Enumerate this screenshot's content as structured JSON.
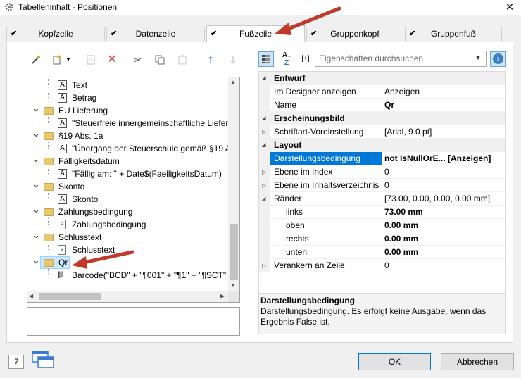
{
  "window": {
    "title": "Tabelleninhalt - Positionen",
    "close_glyph": "✕"
  },
  "tabs": [
    {
      "label": "Kopfzeile",
      "checked": true
    },
    {
      "label": "Datenzeile",
      "checked": true
    },
    {
      "label": "Fußzeile",
      "checked": true,
      "active": true
    },
    {
      "label": "Gruppenkopf",
      "checked": true
    },
    {
      "label": "Gruppenfuß",
      "checked": true
    }
  ],
  "toolbar_icons": [
    "wand-icon",
    "new-object-icon",
    "dropdown-icon",
    "properties-icon",
    "delete-icon",
    "cut-icon",
    "copy-icon",
    "paste-icon",
    "move-up-icon",
    "move-down-icon"
  ],
  "tree": [
    {
      "kind": "text",
      "label": "Text"
    },
    {
      "kind": "text",
      "label": "Betrag"
    },
    {
      "kind": "folder",
      "label": "EU Lieferung"
    },
    {
      "kind": "text",
      "label": "\"Steuerfreie innergemeinschaftliche Liefer"
    },
    {
      "kind": "folder",
      "label": "§19 Abs. 1a"
    },
    {
      "kind": "text",
      "label": "\"Übergang der Steuerschuld gemäß §19 Ab"
    },
    {
      "kind": "folder",
      "label": "Fälligkeitsdatum"
    },
    {
      "kind": "text",
      "label": "\"Fällig am: \" + Date$(FaelligkeitsDatum)"
    },
    {
      "kind": "folder",
      "label": "Skonto"
    },
    {
      "kind": "text",
      "label": "Skonto"
    },
    {
      "kind": "folder",
      "label": "Zahlungsbedingung"
    },
    {
      "kind": "para",
      "label": "Zahlungsbedingung"
    },
    {
      "kind": "folder",
      "label": "Schlusstext"
    },
    {
      "kind": "para",
      "label": "Schlusstext"
    },
    {
      "kind": "folder",
      "label": "Qr"
    },
    {
      "kind": "barcode",
      "label": "Barcode(\"BCD\" + \"¶001\" + \"¶1\" + \"¶SCT\" + "
    }
  ],
  "search": {
    "placeholder": "Eigenschaften durchsuchen"
  },
  "properties": [
    {
      "type": "cat",
      "name": "Entwurf"
    },
    {
      "type": "prop",
      "name": "Im Designer anzeigen",
      "value": "Anzeigen"
    },
    {
      "type": "prop",
      "name": "Name",
      "value": "Qr",
      "bold": true
    },
    {
      "type": "cat",
      "name": "Erscheinungsbild"
    },
    {
      "type": "prop",
      "name": "Schriftart-Voreinstellung",
      "value": "[Arial, 9.0 pt]",
      "toggle": true
    },
    {
      "type": "cat",
      "name": "Layout"
    },
    {
      "type": "prop",
      "name": "Darstellungsbedingung",
      "value": "not IsNullOrE... [Anzeigen]",
      "bold": true,
      "selected": true
    },
    {
      "type": "prop",
      "name": "Ebene im Index",
      "value": "0",
      "toggle": true
    },
    {
      "type": "prop",
      "name": "Ebene im Inhaltsverzeichnis",
      "value": "0",
      "toggle": true
    },
    {
      "type": "prop",
      "name": "Ränder",
      "value": "[73.00, 0.00, 0.00, 0.00 mm]",
      "toggle": true,
      "open": true
    },
    {
      "type": "sub",
      "name": "links",
      "value": "73.00 mm",
      "bold": true
    },
    {
      "type": "sub",
      "name": "oben",
      "value": "0.00 mm",
      "bold": true
    },
    {
      "type": "sub",
      "name": "rechts",
      "value": "0.00 mm",
      "bold": true
    },
    {
      "type": "sub",
      "name": "unten",
      "value": "0.00 mm",
      "bold": true
    },
    {
      "type": "prop",
      "name": "Verankern an Zeile",
      "value": "0",
      "toggle": true
    }
  ],
  "description": {
    "title": "Darstellungsbedingung",
    "text": "Darstellungsbedingung. Es erfolgt keine Ausgabe, wenn das Ergebnis False ist."
  },
  "buttons": {
    "ok": "OK",
    "cancel": "Abbrechen",
    "help": "?"
  },
  "colors": {
    "accent": "#0078d7",
    "arrow": "#c0392b",
    "folder": "#e8c86f"
  }
}
